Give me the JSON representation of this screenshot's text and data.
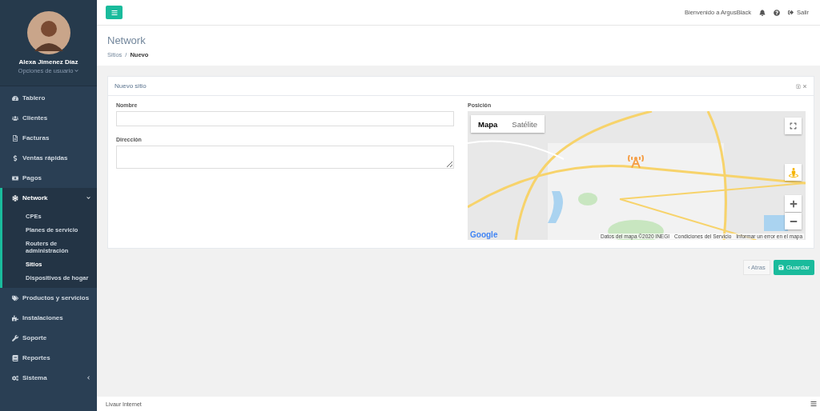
{
  "sidebar": {
    "user": {
      "name": "Alexa Jimenez Díaz",
      "options": "Opciones de usuario"
    },
    "items": [
      {
        "label": "Tablero",
        "kind": "link"
      },
      {
        "label": "Clientes",
        "kind": "link"
      },
      {
        "label": "Facturas",
        "kind": "link"
      },
      {
        "label": "Ventas rápidas",
        "kind": "link"
      },
      {
        "label": "Pagos",
        "kind": "link"
      },
      {
        "label": "Network",
        "kind": "group",
        "expanded": true,
        "children": [
          {
            "label": "CPEs",
            "selected": false
          },
          {
            "label": "Planes de servicio",
            "selected": false
          },
          {
            "label": "Routers de administración",
            "selected": false
          },
          {
            "label": "Sitios",
            "selected": true
          },
          {
            "label": "Dispositivos de hogar",
            "selected": false
          }
        ]
      },
      {
        "label": "Productos y servicios",
        "kind": "link"
      },
      {
        "label": "Instalaciones",
        "kind": "link"
      },
      {
        "label": "Soporte",
        "kind": "link"
      },
      {
        "label": "Reportes",
        "kind": "link"
      },
      {
        "label": "Sistema",
        "kind": "group",
        "expanded": false
      }
    ]
  },
  "topbar": {
    "welcome": "Bienvenido a ArgusBlack",
    "logout": "Salir"
  },
  "page": {
    "title": "Network",
    "breadcrumb": [
      "Sitios",
      "Nuevo"
    ],
    "breadcrumb_separator": "/"
  },
  "card": {
    "title": "Nuevo sitio",
    "fields": [
      {
        "label": "Nombre",
        "kind": "input"
      },
      {
        "label": "Dirección",
        "kind": "textarea"
      }
    ],
    "map": {
      "label": "Posición",
      "map_types": [
        {
          "label": "Mapa",
          "selected": true
        },
        {
          "label": "Satélite",
          "selected": false
        }
      ],
      "logo": "Google",
      "attribution": "Datos del mapa ©2020 INEGI",
      "terms": "Condiciones del Servicio",
      "report": "Informar un error en el mapa"
    }
  },
  "actions": {
    "back": "‹ Atras",
    "save": "Guardar"
  },
  "footer": {
    "text": "Livaur Internet"
  }
}
